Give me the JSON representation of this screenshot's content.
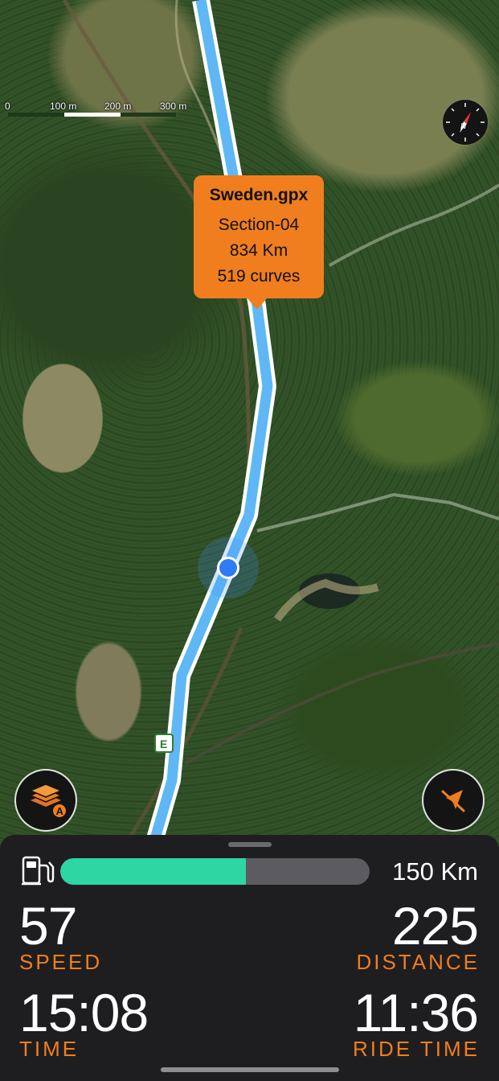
{
  "map": {
    "scale": {
      "labels": [
        "0",
        "100 m",
        "200 m",
        "300 m"
      ]
    },
    "compass": {
      "icon": "compass-icon",
      "letter": "N"
    },
    "route": {
      "color": "#5fb8f5",
      "outline": "#ffffff"
    },
    "road_sign": "E",
    "callout": {
      "title": "Sweden.gpx",
      "section": "Section-04",
      "distance": "834 Km",
      "curves": "519 curves",
      "color": "#f07e1e"
    },
    "buttons": {
      "layers": {
        "icon": "map-layers-icon",
        "badge": "A"
      },
      "recenter": {
        "icon": "location-arrow-icon"
      }
    }
  },
  "panel": {
    "fuel": {
      "icon": "fuel-pump-icon",
      "level_percent": 60,
      "range": "150 Km",
      "color": "#2ed6a4"
    },
    "speed": {
      "value": "57",
      "label": "SPEED"
    },
    "distance": {
      "value": "225",
      "label": "DISTANCE"
    },
    "time": {
      "value": "15:08",
      "label": "TIME"
    },
    "ride_time": {
      "value": "11:36",
      "label": "RIDE TIME"
    },
    "accent": "#f07e1e"
  }
}
